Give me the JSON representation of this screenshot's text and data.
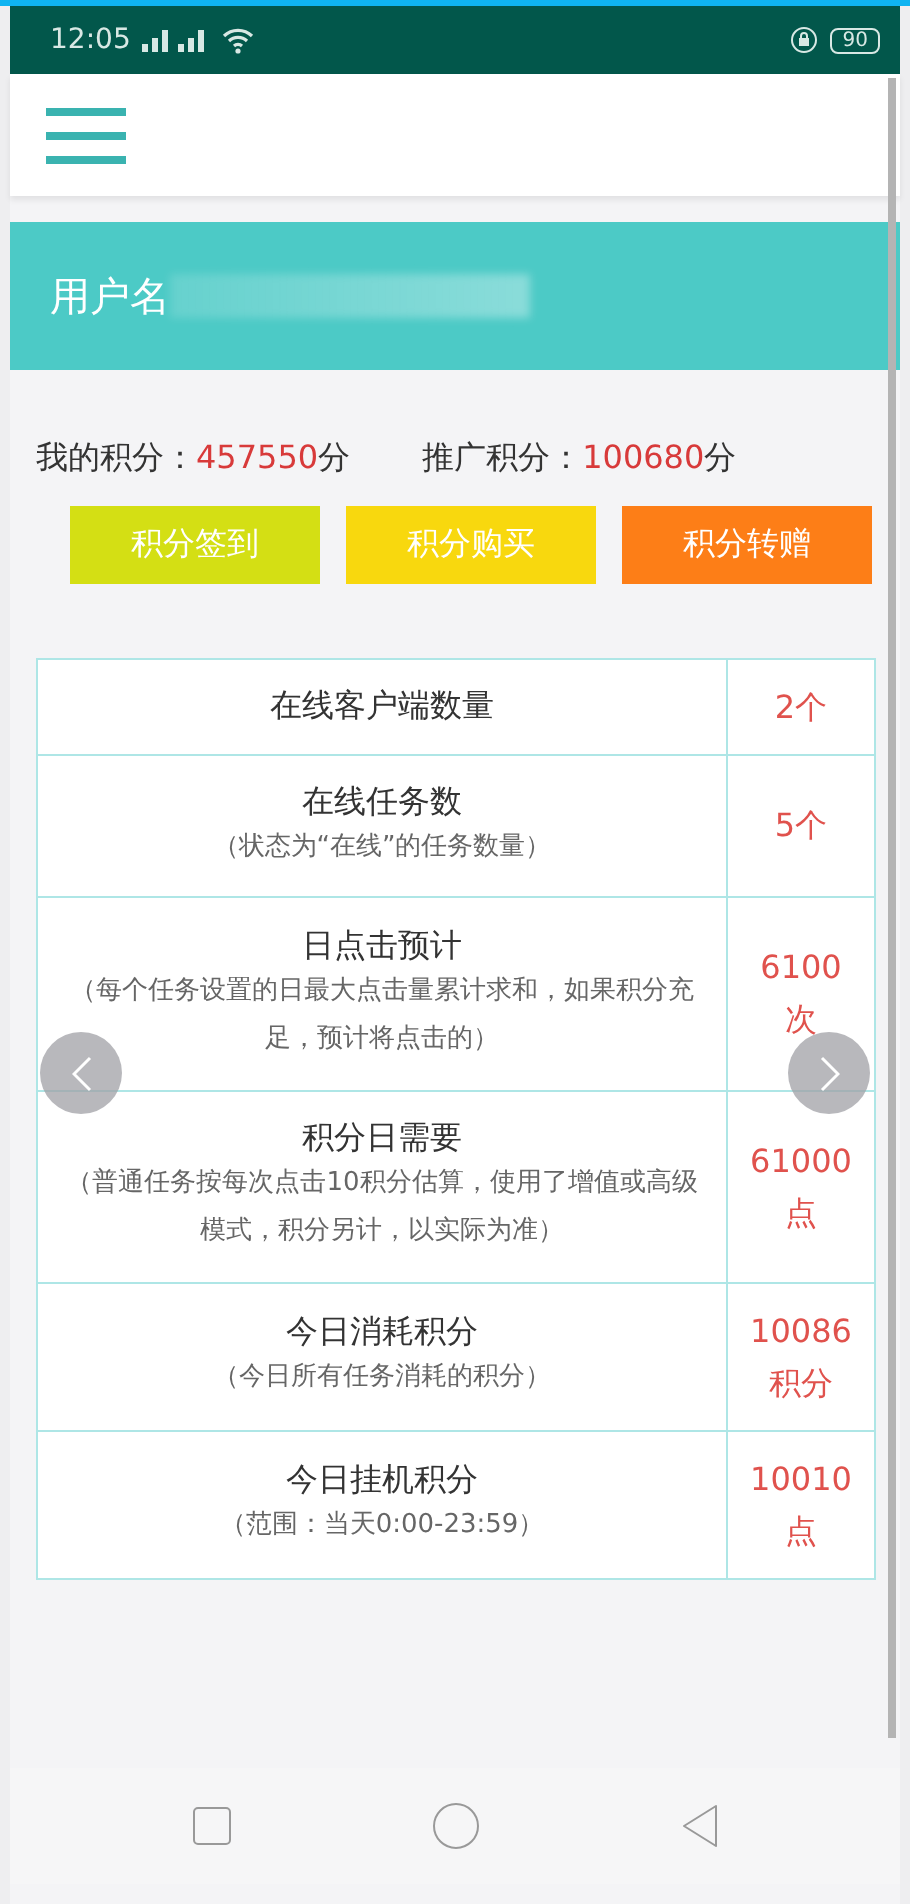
{
  "status_bar": {
    "time": "12:05",
    "battery": "90"
  },
  "header": {
    "label": "用户名"
  },
  "points": [
    {
      "label": "我的积分：",
      "value": "457550",
      "unit": "分"
    },
    {
      "label": "推广积分：",
      "value": "100680",
      "unit": "分"
    }
  ],
  "buttons": [
    {
      "label": "积分签到",
      "color": "#d4df14"
    },
    {
      "label": "积分购买",
      "color": "#f8d80e"
    },
    {
      "label": "积分转赠",
      "color": "#fd7e17"
    }
  ],
  "table": {
    "rows": [
      {
        "title": "在线客户端数量",
        "value": "2个"
      },
      {
        "title": "在线任务数",
        "note": "（状态为“在线”的任务数量）",
        "value": "5个"
      },
      {
        "title": "日点击预计",
        "note": "（每个任务设置的日最大点击量累计求和，如果积分充足，预计将点击的）",
        "value": "6100次"
      },
      {
        "title": "积分日需要",
        "note": "（普通任务按每次点击10积分估算，使用了增值或高级模式，积分另计，以实际为准）",
        "value": "61000点"
      },
      {
        "title": "今日消耗积分",
        "note": "（今日所有任务消耗的积分）",
        "value": "10086积分"
      },
      {
        "title": "今日挂机积分",
        "note": "（范围：当天0:00-23:59）",
        "value": "10010点"
      }
    ]
  }
}
